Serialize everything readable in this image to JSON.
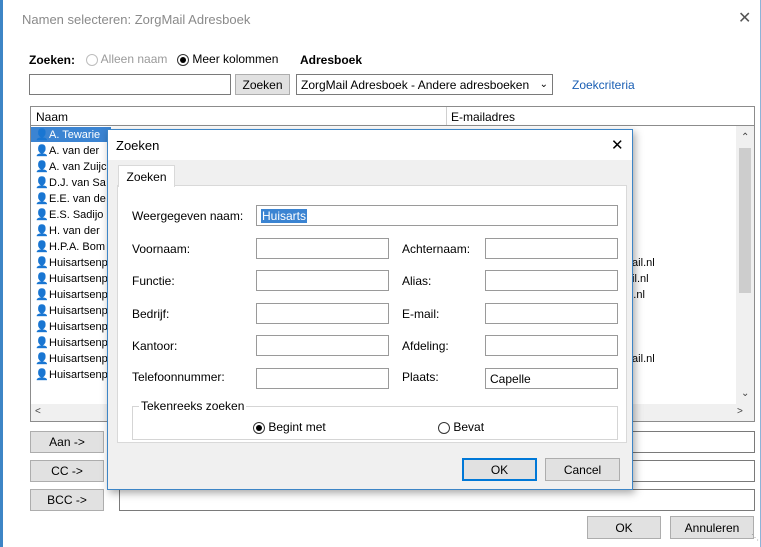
{
  "window": {
    "title": "Namen selecteren: ZorgMail Adresboek",
    "close_glyph": "✕"
  },
  "search": {
    "label": "Zoeken:",
    "option_name_only": "Alleen naam",
    "option_more_columns": "Meer kolommen",
    "input_value": "",
    "button": "Zoeken"
  },
  "addressbook": {
    "label": "Adresboek",
    "selected": "ZorgMail Adresboek - Andere adresboeken",
    "criteria_link": "Zoekcriteria"
  },
  "list": {
    "columns": [
      "Naam",
      "E-mailadres"
    ],
    "rows": [
      {
        "name": "A. Tewarie",
        "email": "",
        "selected": true
      },
      {
        "name": "A. van der",
        "email": ""
      },
      {
        "name": "A. van Zuijc",
        "email": ""
      },
      {
        "name": "D.J. van Sa",
        "email": ""
      },
      {
        "name": "E.E. van de",
        "email": ""
      },
      {
        "name": "E.S. Sadijo",
        "email": ""
      },
      {
        "name": "H. van der",
        "email": ""
      },
      {
        "name": "H.P.A. Bom",
        "email": ""
      },
      {
        "name": "Huisartsenp",
        "email": "orgmail.nl"
      },
      {
        "name": "Huisartsenp",
        "email": "rgmail.nl"
      },
      {
        "name": "Huisartsenp",
        "email": "gmail.nl"
      },
      {
        "name": "Huisartsenp",
        "email": ".nl"
      },
      {
        "name": "Huisartsenp",
        "email": "l.nl"
      },
      {
        "name": "Huisartsenp",
        "email": "nl"
      },
      {
        "name": "Huisartsenp",
        "email": "orgmail.nl"
      },
      {
        "name": "Huisartsenp",
        "email": "ail.nl"
      }
    ]
  },
  "recipients": {
    "to": "Aan ->",
    "cc": "CC ->",
    "bcc": "BCC ->"
  },
  "footer": {
    "ok": "OK",
    "cancel": "Annuleren"
  },
  "dialog": {
    "title": "Zoeken",
    "close_glyph": "✕",
    "tab": "Zoeken",
    "fields": {
      "display_name": {
        "label": "Weergegeven naam:",
        "value": "Huisarts"
      },
      "first_name": {
        "label": "Voornaam:",
        "value": ""
      },
      "last_name": {
        "label": "Achternaam:",
        "value": ""
      },
      "function": {
        "label": "Functie:",
        "value": ""
      },
      "alias": {
        "label": "Alias:",
        "value": ""
      },
      "company": {
        "label": "Bedrijf:",
        "value": ""
      },
      "email": {
        "label": "E-mail:",
        "value": ""
      },
      "office": {
        "label": "Kantoor:",
        "value": ""
      },
      "department": {
        "label": "Afdeling:",
        "value": ""
      },
      "phone": {
        "label": "Telefoonnummer:",
        "value": ""
      },
      "city": {
        "label": "Plaats:",
        "value": "Capelle"
      }
    },
    "string_group": {
      "label": "Tekenreeks zoeken",
      "begins_with": "Begint met",
      "contains": "Bevat",
      "selected": "begins_with"
    },
    "ok": "OK",
    "cancel": "Cancel"
  }
}
